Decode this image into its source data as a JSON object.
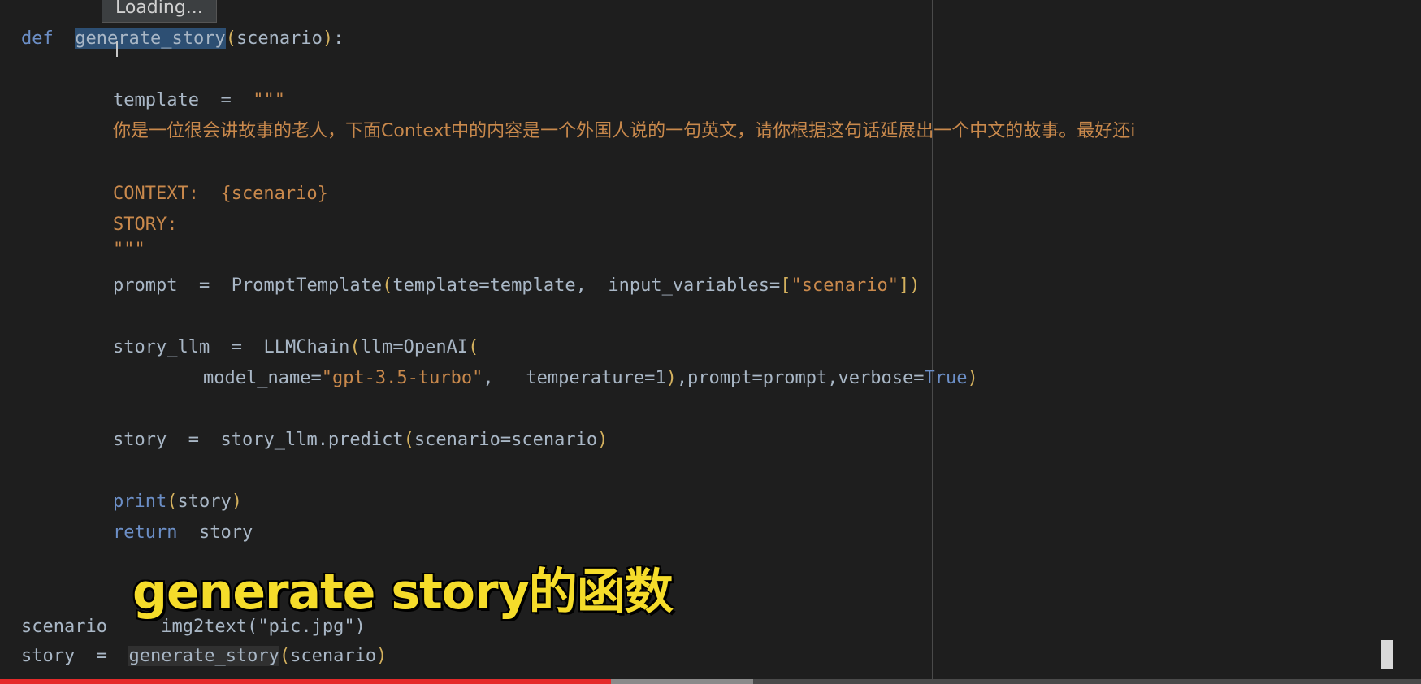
{
  "tooltip": {
    "text": "Loading..."
  },
  "code": {
    "l1": {
      "kw": "def",
      "name": "generate_story",
      "lp": "(",
      "arg": "scenario",
      "rp": ")",
      "colon": ":"
    },
    "l2": {
      "lhs": "template",
      "eq": "=",
      "str": "\"\"\""
    },
    "l3": {
      "text": "你是一位很会讲故事的老人，下面Context中的内容是一个外国人说的一句英文，请你根据这句话延展出一个中文的故事。最好还i"
    },
    "l4": {
      "text": "CONTEXT:  {scenario}"
    },
    "l5": {
      "text": "STORY:"
    },
    "l6": {
      "text": "\"\"\""
    },
    "l7": {
      "lhs": "prompt",
      "eq": "=",
      "call": "PromptTemplate",
      "lp": "(",
      "args1": "template=template,",
      "args2": "input_variables=",
      "lb": "[",
      "sval": "\"scenario\"",
      "rb": "]",
      "rp": ")"
    },
    "l8": {
      "lhs": "story_llm",
      "eq": "=",
      "call": "LLMChain",
      "lp": "(",
      "arg": "llm=OpenAI",
      "lp2": "("
    },
    "l9": {
      "a1": "model_name=",
      "s1": "\"gpt-3.5-turbo\"",
      "a2": ",   temperature=1",
      "rp": ")",
      "a3": ",prompt=prompt,verbose=",
      "tv": "True",
      "rp2": ")"
    },
    "l10": {
      "lhs": "story",
      "eq": "=",
      "call": "story_llm.predict",
      "lp": "(",
      "arg": "scenario=scenario",
      "rp": ")"
    },
    "l11": {
      "call": "print",
      "lp": "(",
      "arg": "story",
      "rp": ")"
    },
    "l12": {
      "kw": "return",
      "arg": "story"
    },
    "l13": {
      "lhs": "scenario",
      "rest": "img2text(\"pic.jpg\")"
    },
    "l14": {
      "lhs": "story",
      "eq": "=",
      "call": "generate_story",
      "lp": "(",
      "arg": "scenario",
      "rp": ")"
    }
  },
  "subtitle": {
    "text": "generate story的函数"
  },
  "video": {
    "progress": 0.43,
    "buffered": 0.53
  }
}
